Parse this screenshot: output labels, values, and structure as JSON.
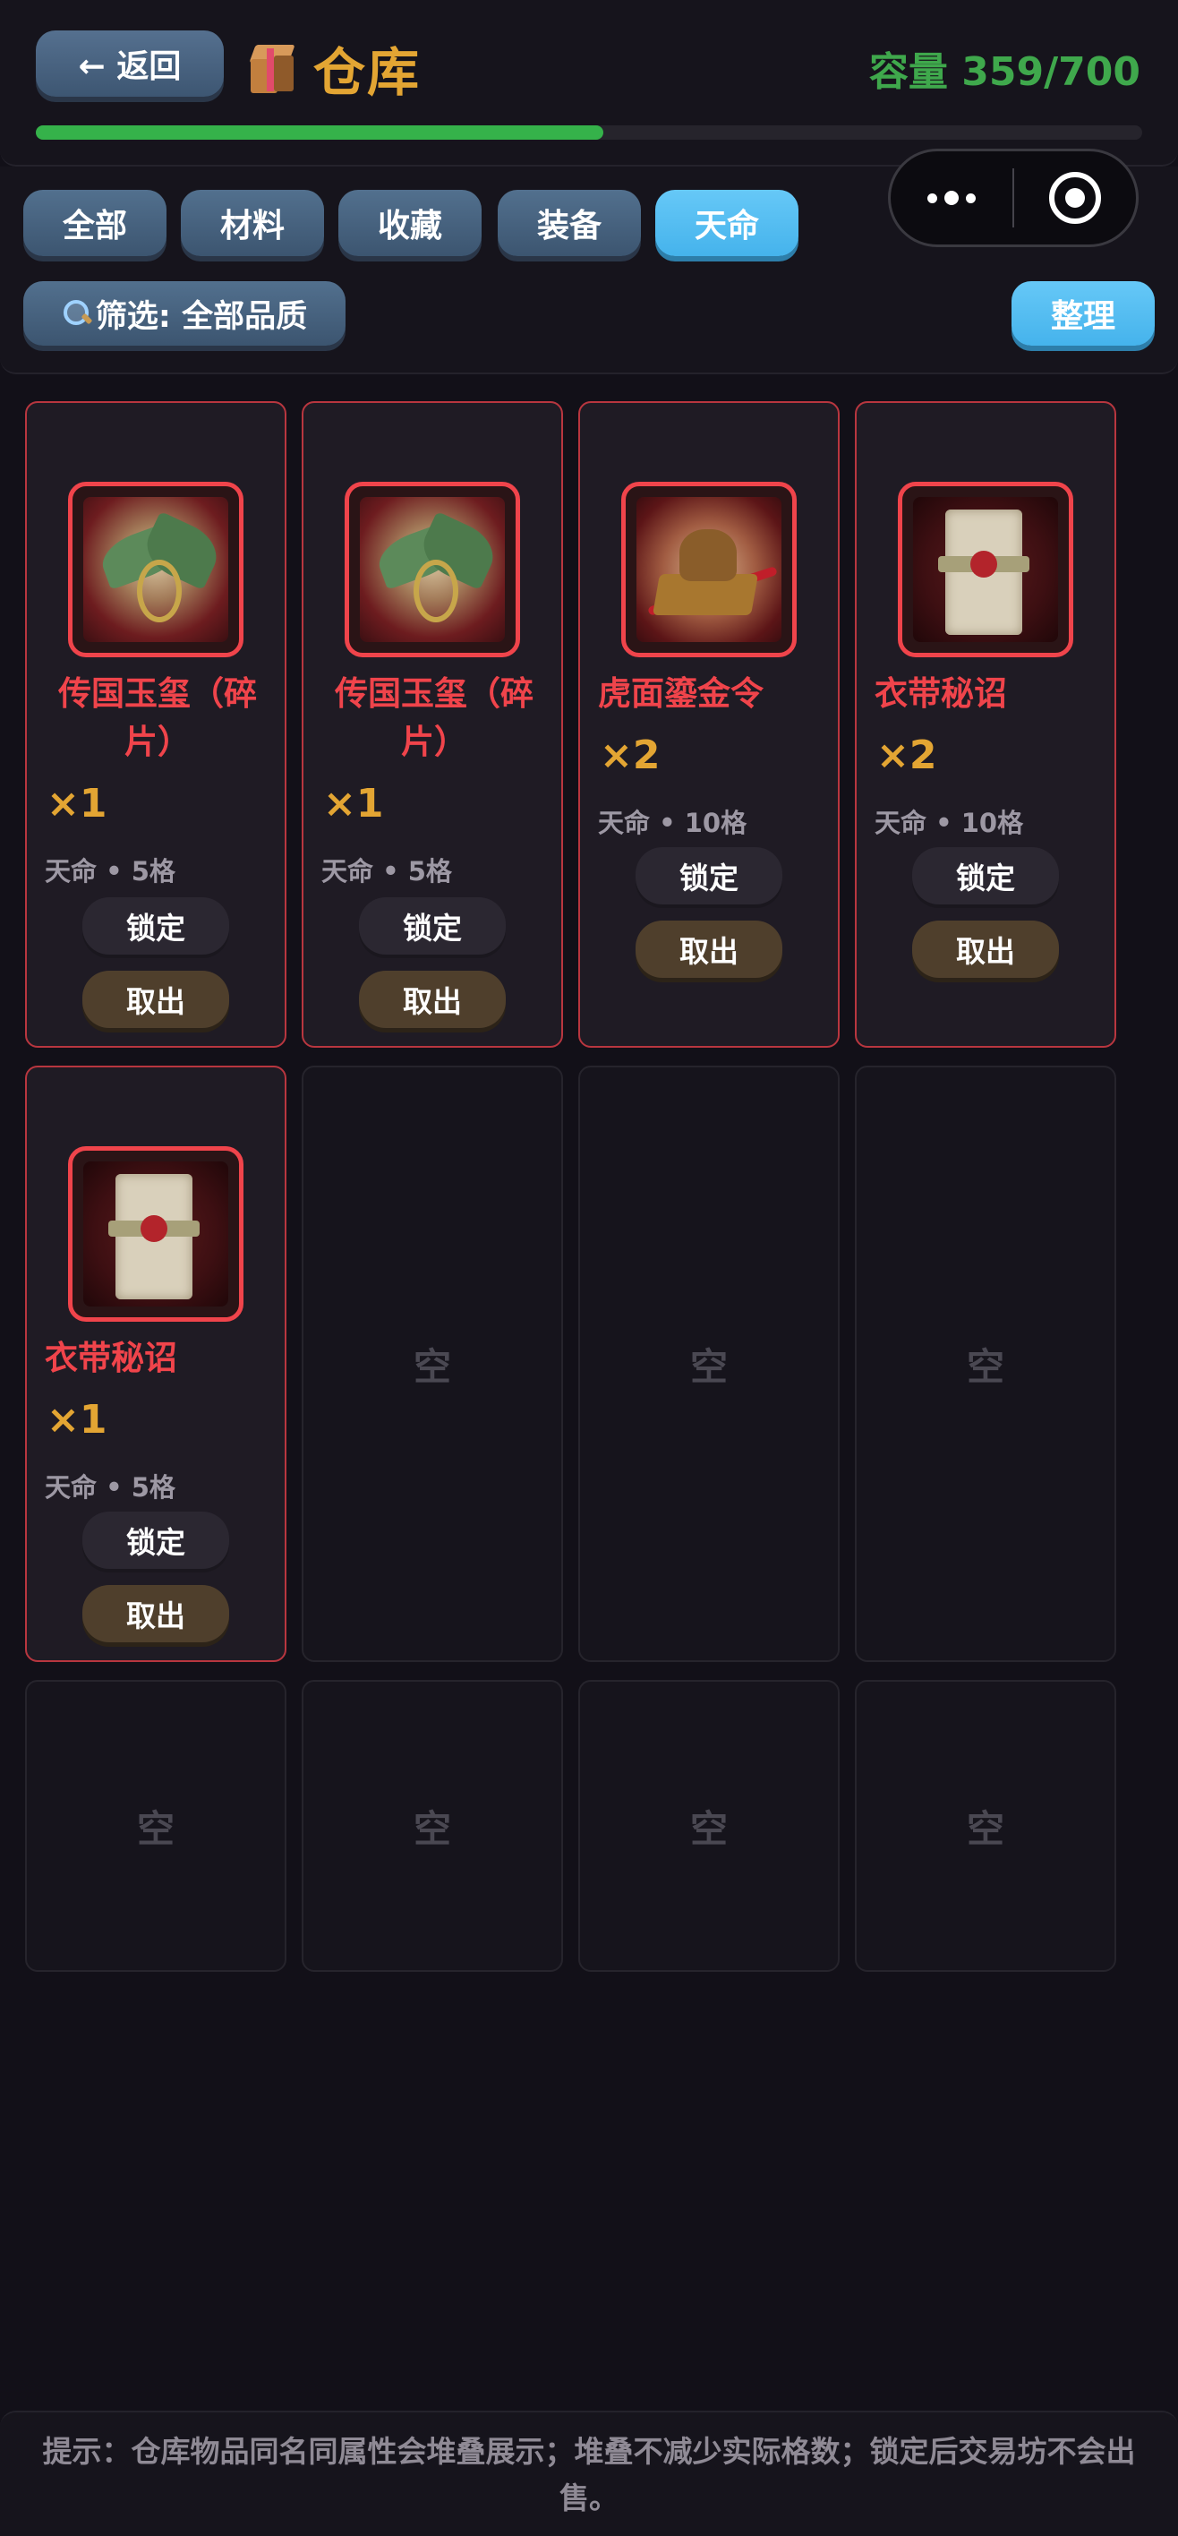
{
  "header": {
    "back_label": "← 返回",
    "title": "仓库",
    "title_icon": "package-icon",
    "capacity_label": "容量",
    "capacity_value": "359/700",
    "capacity_used": 359,
    "capacity_total": 700,
    "progress_color": "#35b24a"
  },
  "capsule": {
    "more_icon": "more-dots-icon",
    "close_icon": "target-icon"
  },
  "tabs": [
    {
      "label": "全部",
      "active": false
    },
    {
      "label": "材料",
      "active": false
    },
    {
      "label": "收藏",
      "active": false
    },
    {
      "label": "装备",
      "active": false
    },
    {
      "label": "天命",
      "active": true
    }
  ],
  "filter": {
    "icon": "magnifier-icon",
    "label": "筛选: 全部品质"
  },
  "sort_label": "整理",
  "items": [
    {
      "name": "传国玉玺（碎片）",
      "qty": "×1",
      "meta": "天命 • 5格",
      "lock_label": "锁定",
      "take_label": "取出",
      "image": "jade-seal-icon"
    },
    {
      "name": "传国玉玺（碎片）",
      "qty": "×1",
      "meta": "天命 • 5格",
      "lock_label": "锁定",
      "take_label": "取出",
      "image": "jade-seal-icon"
    },
    {
      "name": "虎面鎏金令",
      "qty": "×2",
      "meta": "天命 • 10格",
      "lock_label": "锁定",
      "take_label": "取出",
      "image": "tiger-token-icon"
    },
    {
      "name": "衣带秘诏",
      "qty": "×2",
      "meta": "天命 • 10格",
      "lock_label": "锁定",
      "take_label": "取出",
      "image": "secret-scroll-icon"
    },
    {
      "name": "衣带秘诏",
      "qty": "×1",
      "meta": "天命 • 5格",
      "lock_label": "锁定",
      "take_label": "取出",
      "image": "secret-scroll-icon"
    }
  ],
  "empty_label": "空",
  "footer_hint": "提示：仓库物品同名同属性会堆叠展示；堆叠不减少实际格数；锁定后交易坊不会出售。",
  "colors": {
    "accent_gold": "#e3a533",
    "capacity_green": "#3fa84c",
    "item_red": "#f0444b",
    "tab_active": "#45b3ec"
  }
}
